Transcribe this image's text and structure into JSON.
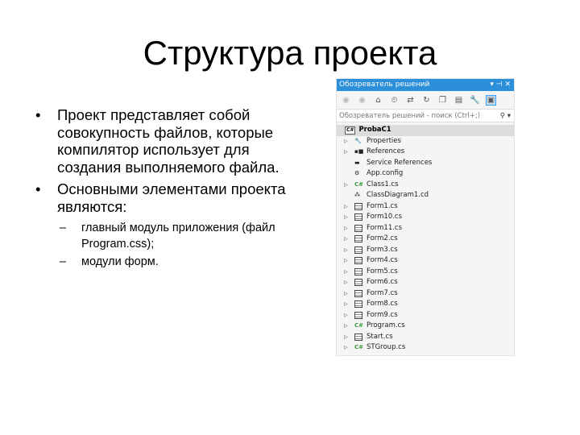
{
  "slide": {
    "title": "Структура проекта",
    "bullets": [
      "Проект представляет собой совокупность файлов, которые компилятор использует для создания выполняемого файла.",
      "Основными элементами проекта являются:"
    ],
    "subbullets": [
      "главный модуль приложения (файл Program.css);",
      " модули форм."
    ]
  },
  "solution_explorer": {
    "title": "Обозреватель решений",
    "title_controls": "▾ ⊣ ✕",
    "search_placeholder": "Обозреватель решений - поиск (Ctrl+;)",
    "accent": "#2c8fd9",
    "root": {
      "badge": "C#",
      "label": "ProbaC1"
    },
    "items": [
      {
        "label": "Properties",
        "icon": "wrench-icon",
        "exp": true
      },
      {
        "label": "References",
        "icon": "references-icon",
        "exp": true
      },
      {
        "label": "Service References",
        "icon": "folder-icon",
        "exp": false
      },
      {
        "label": "App.config",
        "icon": "config-icon",
        "exp": false
      },
      {
        "label": "Class1.cs",
        "icon": "csharp-icon",
        "exp": true
      },
      {
        "label": "ClassDiagram1.cd",
        "icon": "class-diagram-icon",
        "exp": false
      },
      {
        "label": "Form1.cs",
        "icon": "form-icon",
        "exp": true
      },
      {
        "label": "Form10.cs",
        "icon": "form-icon",
        "exp": true
      },
      {
        "label": "Form11.cs",
        "icon": "form-icon",
        "exp": true
      },
      {
        "label": "Form2.cs",
        "icon": "form-icon",
        "exp": true
      },
      {
        "label": "Form3.cs",
        "icon": "form-icon",
        "exp": true
      },
      {
        "label": "Form4.cs",
        "icon": "form-icon",
        "exp": true
      },
      {
        "label": "Form5.cs",
        "icon": "form-icon",
        "exp": true
      },
      {
        "label": "Form6.cs",
        "icon": "form-icon",
        "exp": true
      },
      {
        "label": "Form7.cs",
        "icon": "form-icon",
        "exp": true
      },
      {
        "label": "Form8.cs",
        "icon": "form-icon",
        "exp": true
      },
      {
        "label": "Form9.cs",
        "icon": "form-icon",
        "exp": true
      },
      {
        "label": "Program.cs",
        "icon": "csharp-icon",
        "exp": true
      },
      {
        "label": "Start.cs",
        "icon": "form-icon",
        "exp": true
      },
      {
        "label": "STGroup.cs",
        "icon": "csharp-icon",
        "exp": true
      }
    ]
  }
}
